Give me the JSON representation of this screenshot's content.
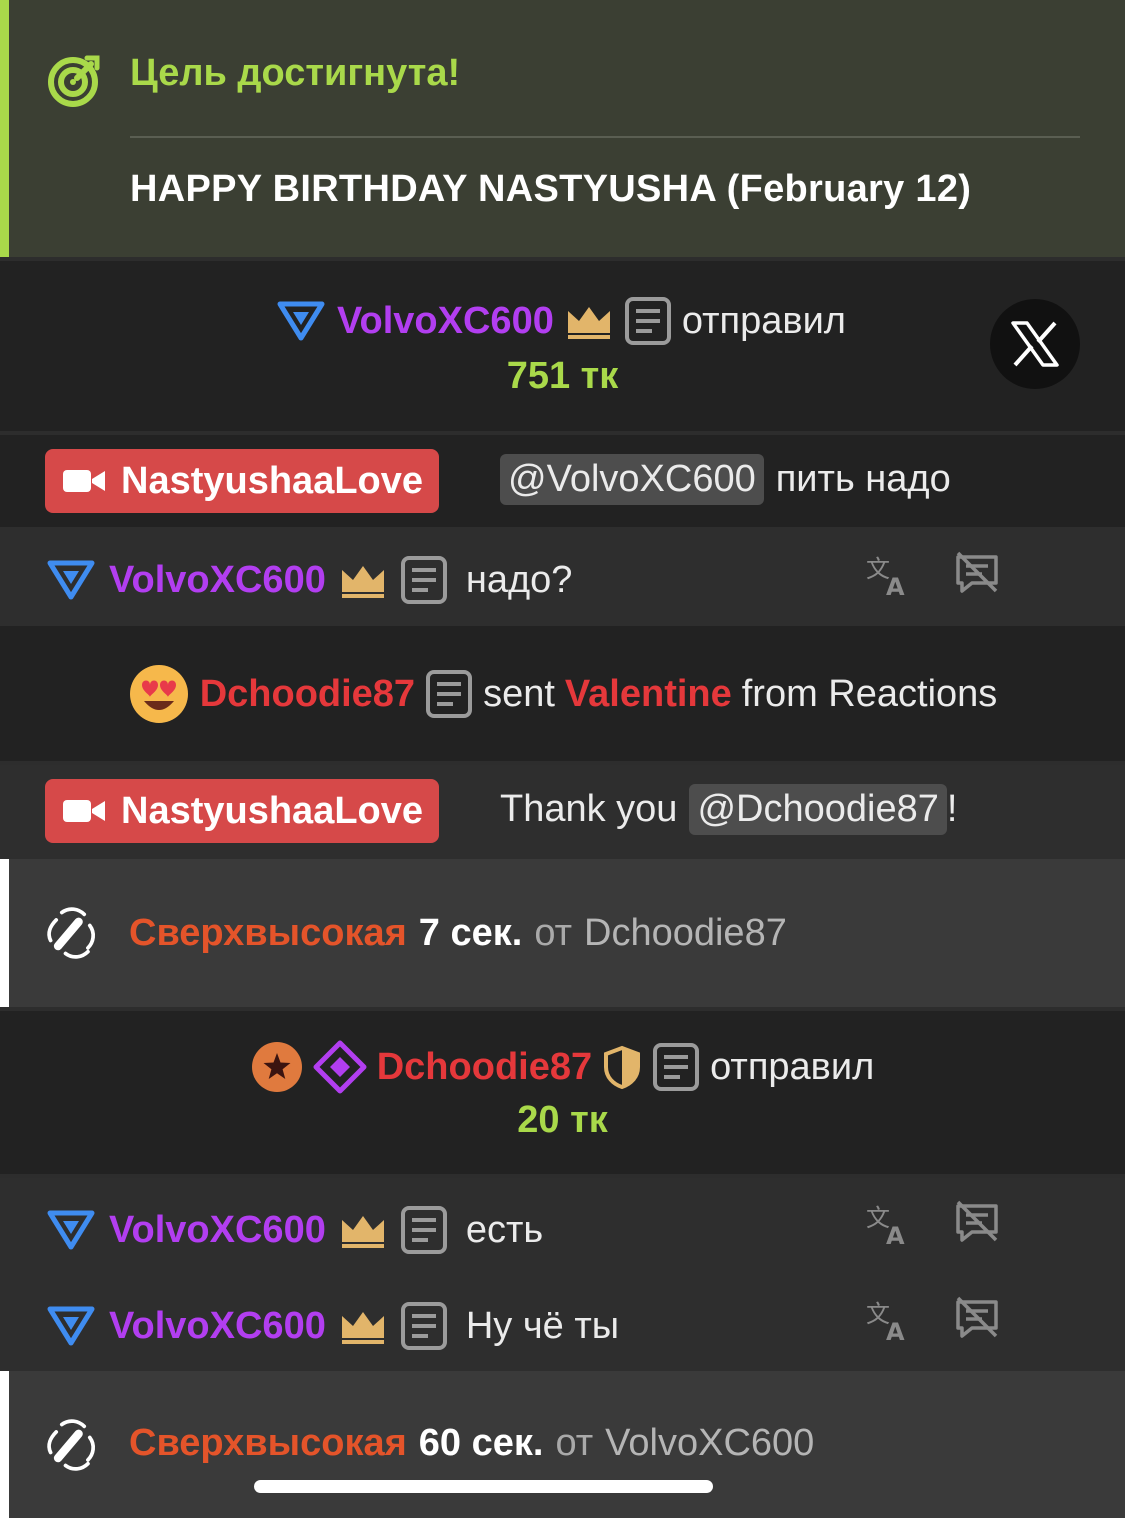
{
  "goal": {
    "title": "Цель достигнута!",
    "text": "HAPPY BIRTHDAY NASTYUSHA (February 12)",
    "accent_color": "#a9d94a",
    "icon": "target-check-icon"
  },
  "tip1": {
    "user": "VolvoXC600",
    "verb": "отправил",
    "amount": "751 тк"
  },
  "close_button": {
    "icon": "x-close-icon"
  },
  "msg1": {
    "user": "NastyushaaLove",
    "mention": "@VolvoXC600",
    "text": "пить надо"
  },
  "msg2": {
    "user": "VolvoXC600",
    "text": "надо?"
  },
  "reaction": {
    "user": "Dchoodie87",
    "pre": "sent",
    "item": "Valentine",
    "post": "from Reactions"
  },
  "msg3": {
    "user": "NastyushaaLove",
    "pre": "Thank you",
    "mention": "@Dchoodie87",
    "post": "!"
  },
  "vibe1": {
    "level": "Сверхвысокая",
    "duration": "7 сек.",
    "from": "от",
    "user": "Dchoodie87"
  },
  "tip2": {
    "user": "Dchoodie87",
    "verb": "отправил",
    "amount": "20 тк"
  },
  "msg4": {
    "user": "VolvoXC600",
    "text": "есть"
  },
  "msg5": {
    "user": "VolvoXC600",
    "text": "Ну чё ты"
  },
  "vibe2": {
    "level": "Сверхвысокая",
    "duration": "60 сек.",
    "from": "от",
    "user": "VolvoXC600"
  },
  "colors": {
    "purple_user": "#b23ef0",
    "red_user": "#e5383b",
    "token_green": "#a9d94a",
    "broadcaster_badge": "#d64949",
    "vibe_orange": "#e4542a"
  }
}
